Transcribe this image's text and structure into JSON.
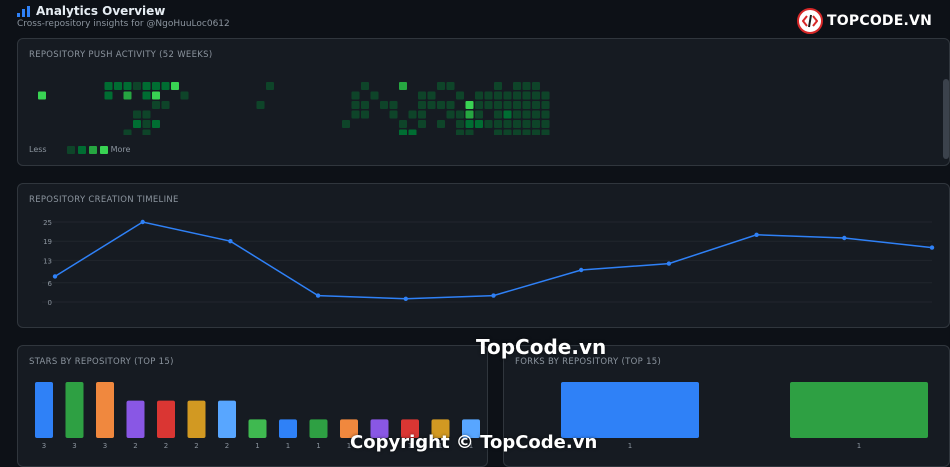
{
  "header": {
    "title": "Analytics Overview",
    "subtitle": "Cross-repository insights for @NgoHuuLoc0612",
    "icon": "bar-chart-icon",
    "accent": "#2f81f7"
  },
  "logo": {
    "text": "TOPCODE.VN",
    "icon": "topcode-logo-icon"
  },
  "heatmap": {
    "title": "REPOSITORY PUSH ACTIVITY (52 WEEKS)",
    "legend_less": "Less",
    "legend_more": "More",
    "colors": [
      "#0e4429",
      "#006d32",
      "#26a641",
      "#39d353"
    ],
    "cells": [
      [
        0,
        1,
        3
      ],
      [
        7,
        0,
        1
      ],
      [
        7,
        1,
        1
      ],
      [
        8,
        0,
        1
      ],
      [
        8,
        6,
        1
      ],
      [
        9,
        0,
        1
      ],
      [
        9,
        1,
        2
      ],
      [
        9,
        5,
        0
      ],
      [
        10,
        0,
        0
      ],
      [
        10,
        3,
        0
      ],
      [
        10,
        4,
        1
      ],
      [
        11,
        0,
        1
      ],
      [
        11,
        1,
        1
      ],
      [
        11,
        3,
        0
      ],
      [
        11,
        4,
        0
      ],
      [
        11,
        5,
        0
      ],
      [
        11,
        6,
        2
      ],
      [
        12,
        0,
        1
      ],
      [
        12,
        1,
        3
      ],
      [
        12,
        2,
        0
      ],
      [
        12,
        4,
        1
      ],
      [
        12,
        6,
        0
      ],
      [
        13,
        0,
        1
      ],
      [
        13,
        2,
        0
      ],
      [
        13,
        6,
        3
      ],
      [
        14,
        0,
        3
      ],
      [
        14,
        6,
        1
      ],
      [
        15,
        1,
        0
      ],
      [
        23,
        2,
        0
      ],
      [
        24,
        0,
        0
      ],
      [
        32,
        4,
        0
      ],
      [
        33,
        1,
        0
      ],
      [
        33,
        2,
        0
      ],
      [
        33,
        3,
        0
      ],
      [
        34,
        0,
        0
      ],
      [
        34,
        2,
        0
      ],
      [
        34,
        3,
        0
      ],
      [
        35,
        1,
        0
      ],
      [
        36,
        2,
        0
      ],
      [
        37,
        2,
        0
      ],
      [
        37,
        3,
        0
      ],
      [
        38,
        0,
        2
      ],
      [
        38,
        4,
        0
      ],
      [
        38,
        5,
        1
      ],
      [
        39,
        3,
        0
      ],
      [
        39,
        5,
        1
      ],
      [
        39,
        6,
        0
      ],
      [
        40,
        1,
        0
      ],
      [
        40,
        2,
        0
      ],
      [
        40,
        3,
        0
      ],
      [
        40,
        4,
        0
      ],
      [
        40,
        6,
        0
      ],
      [
        41,
        1,
        0
      ],
      [
        41,
        2,
        0
      ],
      [
        41,
        6,
        0
      ],
      [
        42,
        0,
        0
      ],
      [
        42,
        2,
        0
      ],
      [
        42,
        4,
        0
      ],
      [
        43,
        0,
        0
      ],
      [
        43,
        2,
        0
      ],
      [
        43,
        3,
        0
      ],
      [
        43,
        6,
        1
      ],
      [
        44,
        1,
        0
      ],
      [
        44,
        3,
        0
      ],
      [
        44,
        4,
        0
      ],
      [
        44,
        5,
        0
      ],
      [
        45,
        2,
        3
      ],
      [
        45,
        3,
        2
      ],
      [
        45,
        4,
        1
      ],
      [
        45,
        5,
        0
      ],
      [
        46,
        1,
        0
      ],
      [
        46,
        2,
        0
      ],
      [
        46,
        3,
        0
      ],
      [
        46,
        4,
        1
      ],
      [
        47,
        1,
        0
      ],
      [
        47,
        2,
        0
      ],
      [
        47,
        4,
        0
      ],
      [
        47,
        6,
        0
      ],
      [
        48,
        0,
        0
      ],
      [
        48,
        1,
        0
      ],
      [
        48,
        2,
        0
      ],
      [
        48,
        3,
        0
      ],
      [
        48,
        4,
        0
      ],
      [
        48,
        5,
        0
      ],
      [
        48,
        6,
        0
      ],
      [
        49,
        1,
        0
      ],
      [
        49,
        2,
        0
      ],
      [
        49,
        3,
        1
      ],
      [
        49,
        4,
        0
      ],
      [
        49,
        5,
        0
      ],
      [
        49,
        6,
        0
      ],
      [
        50,
        0,
        0
      ],
      [
        50,
        1,
        0
      ],
      [
        50,
        2,
        0
      ],
      [
        50,
        3,
        0
      ],
      [
        50,
        4,
        0
      ],
      [
        50,
        5,
        0
      ],
      [
        50,
        6,
        1
      ],
      [
        51,
        0,
        0
      ],
      [
        51,
        1,
        0
      ],
      [
        51,
        2,
        0
      ],
      [
        51,
        3,
        0
      ],
      [
        51,
        4,
        0
      ],
      [
        51,
        5,
        0
      ],
      [
        51,
        6,
        0
      ],
      [
        52,
        0,
        0
      ],
      [
        52,
        1,
        0
      ],
      [
        52,
        2,
        0
      ],
      [
        52,
        3,
        0
      ],
      [
        52,
        4,
        0
      ],
      [
        52,
        5,
        0
      ],
      [
        52,
        6,
        0
      ],
      [
        53,
        1,
        0
      ],
      [
        53,
        2,
        0
      ],
      [
        53,
        3,
        0
      ],
      [
        53,
        4,
        0
      ],
      [
        53,
        5,
        0
      ],
      [
        53,
        6,
        0
      ]
    ]
  },
  "timeline": {
    "title": "REPOSITORY CREATION TIMELINE",
    "line_color": "#2f81f7",
    "y_ticks": [
      "25",
      "19",
      "13",
      "6",
      "0"
    ],
    "y_max": 25,
    "values": [
      8,
      25,
      19,
      2,
      1,
      2,
      10,
      12,
      21,
      20,
      17
    ]
  },
  "stars": {
    "title": "STARS BY REPOSITORY (TOP 15)",
    "values": [
      3,
      3,
      3,
      2,
      2,
      2,
      2,
      1,
      1,
      1,
      1,
      1,
      1,
      1,
      1
    ],
    "labels": [
      "3",
      "3",
      "3",
      "2",
      "2",
      "2",
      "2",
      "1",
      "1",
      "1",
      "1",
      "1",
      "1",
      "1",
      "1"
    ],
    "colors": [
      "#2f81f7",
      "#2ea043",
      "#f0883e",
      "#8957e5",
      "#da3633",
      "#d29922",
      "#58a6ff",
      "#3fb950",
      "#2f81f7",
      "#2ea043",
      "#f0883e",
      "#8957e5",
      "#da3633",
      "#d29922",
      "#58a6ff"
    ]
  },
  "forks": {
    "title": "FORKS BY REPOSITORY (TOP 15)",
    "values": [
      1,
      1
    ],
    "labels": [
      "1",
      "1"
    ],
    "colors": [
      "#2f81f7",
      "#2ea043"
    ]
  },
  "watermarks": {
    "mid": "TopCode.vn",
    "bottom": "Copyright © TopCode.vn"
  }
}
